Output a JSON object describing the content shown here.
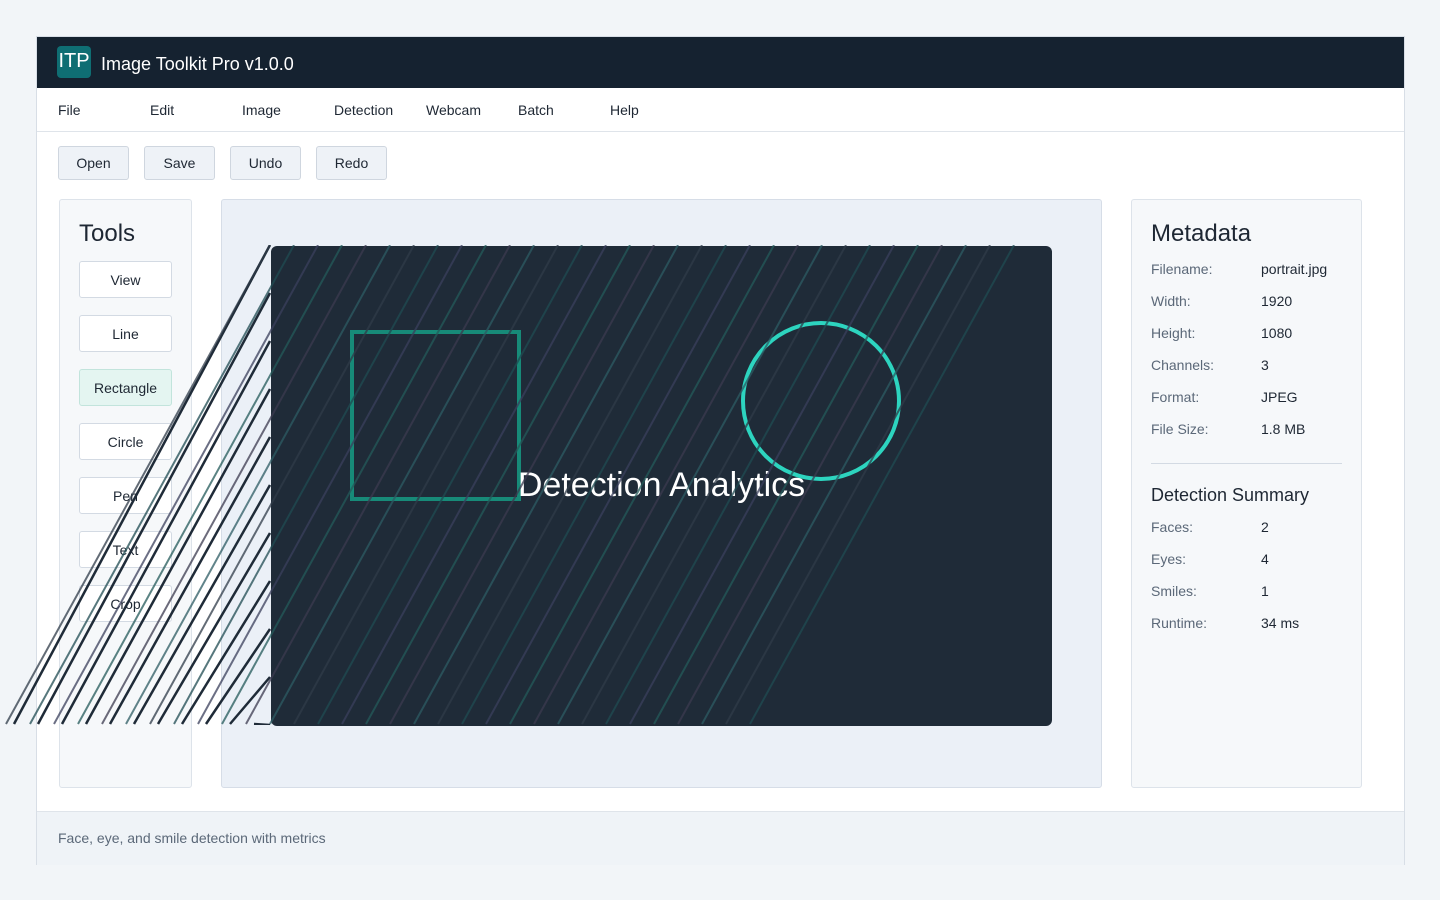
{
  "app": {
    "logo_text": "ITP",
    "title": "Image Toolkit Pro v1.0.0"
  },
  "menu": [
    "File",
    "Edit",
    "Image",
    "Detection",
    "Webcam",
    "Batch",
    "Help"
  ],
  "toolbar": {
    "open_label": "Open",
    "save_label": "Save",
    "undo_label": "Undo",
    "redo_label": "Redo"
  },
  "tools": {
    "title": "Tools",
    "items": [
      "View",
      "Line",
      "Rectangle",
      "Circle",
      "Pen",
      "Text",
      "Crop"
    ],
    "active": "Rectangle"
  },
  "canvas": {
    "overlay_title": "Detection Analytics"
  },
  "metadata": {
    "title": "Metadata",
    "rows": [
      {
        "label": "Filename:",
        "value": "portrait.jpg"
      },
      {
        "label": "Width:",
        "value": "1920"
      },
      {
        "label": "Height:",
        "value": "1080"
      },
      {
        "label": "Channels:",
        "value": "3"
      },
      {
        "label": "Format:",
        "value": "JPEG"
      },
      {
        "label": "File Size:",
        "value": "1.8 MB"
      }
    ]
  },
  "summary": {
    "title": "Detection Summary",
    "rows": [
      {
        "label": "Faces:",
        "value": "2"
      },
      {
        "label": "Eyes:",
        "value": "4"
      },
      {
        "label": "Smiles:",
        "value": "1"
      },
      {
        "label": "Runtime:",
        "value": "34 ms"
      }
    ]
  },
  "status": {
    "text": "Face, eye, and smile detection with metrics"
  },
  "colors": {
    "titlebar": "#152230",
    "accent": "#0f6e73",
    "rect_stroke": "#178a78",
    "circle_stroke": "#2dd4bf",
    "canvas_bg": "#1f2b38"
  }
}
